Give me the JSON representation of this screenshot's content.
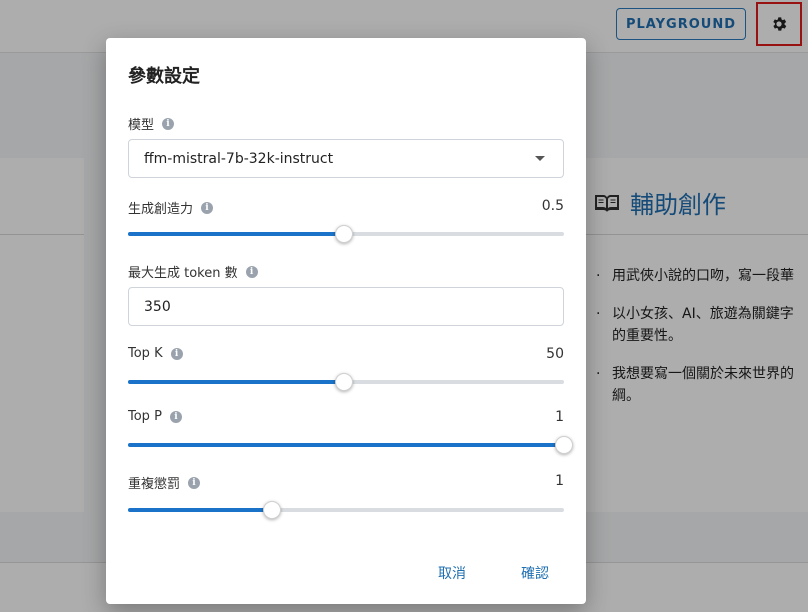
{
  "topbar": {
    "playground_label": "PLAYGROUND"
  },
  "assist": {
    "title": "輔助創作",
    "tips": [
      "用武俠小說的口吻，寫一段華",
      "以小女孩、AI、旅遊為關鍵字\n的重要性。",
      "我想要寫一個關於未來世界的\n綱。"
    ]
  },
  "dialog": {
    "title": "參數設定",
    "model": {
      "label": "模型",
      "value": "ffm-mistral-7b-32k-instruct"
    },
    "creativity": {
      "label": "生成創造力",
      "value": "0.5",
      "fraction": 0.495
    },
    "max_tokens": {
      "label": "最大生成 token 數",
      "value": "350"
    },
    "top_k": {
      "label": "Top K",
      "value": "50",
      "fraction": 0.495
    },
    "top_p": {
      "label": "Top P",
      "value": "1",
      "fraction": 1.0
    },
    "repetition": {
      "label": "重複懲罰",
      "value": "1",
      "fraction": 0.33
    },
    "cancel_label": "取消",
    "confirm_label": "確認"
  },
  "colors": {
    "accent": "#1a73c8",
    "highlight": "#e01b1b"
  }
}
